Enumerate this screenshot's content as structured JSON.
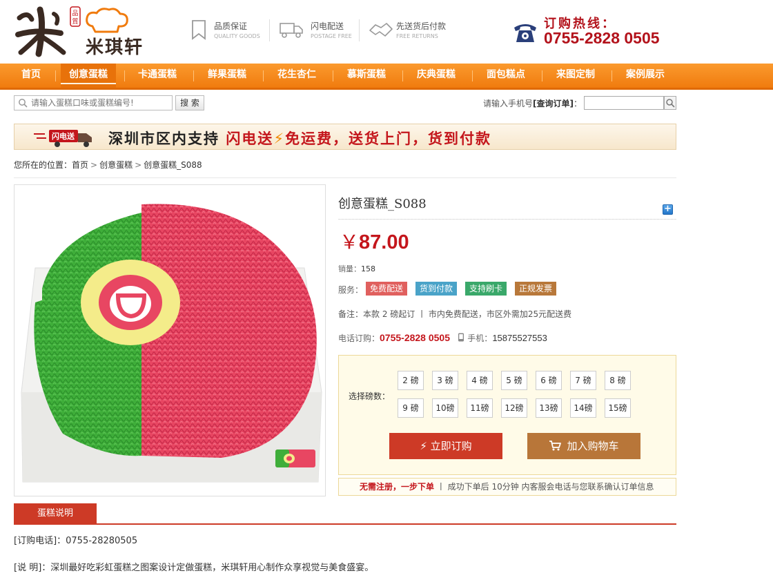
{
  "logo": {
    "text": "米琪轩"
  },
  "features": [
    {
      "title": "品质保证",
      "sub": "QUALITY GOODS",
      "icon": "bookmark-icon"
    },
    {
      "title": "闪电配送",
      "sub": "POSTAGE FREE",
      "icon": "truck-icon"
    },
    {
      "title": "先送货后付款",
      "sub": "FREE RETURNS",
      "icon": "handshake-icon"
    }
  ],
  "hotline": {
    "label": "订购热线：",
    "number": "0755-2828 0505"
  },
  "nav": [
    {
      "label": "首页"
    },
    {
      "label": "创意蛋糕"
    },
    {
      "label": "卡通蛋糕"
    },
    {
      "label": "鲜果蛋糕"
    },
    {
      "label": "花生杏仁"
    },
    {
      "label": "慕斯蛋糕"
    },
    {
      "label": "庆典蛋糕"
    },
    {
      "label": "面包糕点"
    },
    {
      "label": "来图定制"
    },
    {
      "label": "案例展示"
    }
  ],
  "search": {
    "placeholder": "请输入蛋糕口味或蛋糕编号!",
    "button": "搜 索"
  },
  "order_query": {
    "prefix": "请输入手机号",
    "label": "[查询订单]",
    "suffix": "："
  },
  "banner": {
    "part1": "深圳市区内支持",
    "part2": "闪电送",
    "bolt": "⚡",
    "part3": "免运费，送货上门，货到付款",
    "truck_label": "闪电送"
  },
  "breadcrumb": {
    "prefix": "您所在的位置：",
    "items": [
      "首页",
      "创意蛋糕",
      "创意蛋糕_S088"
    ],
    "sep": ">"
  },
  "product": {
    "title": "创意蛋糕_S088",
    "currency": "￥",
    "price": "87.00",
    "sales_label": "销量：",
    "sales": "158",
    "service_label": "服务：",
    "services": [
      {
        "label": "免费配送",
        "color": "#e0605e"
      },
      {
        "label": "货到付款",
        "color": "#4aa3c8"
      },
      {
        "label": "支持刷卡",
        "color": "#3aa86a"
      },
      {
        "label": "正规发票",
        "color": "#b8783a"
      }
    ],
    "note": "备注：本款 2 磅起订 丨 市内免费配送，市区外需加25元配送费",
    "phone_label": "电话订购：",
    "phone": "0755-2828 0505",
    "mobile_label": "手机：",
    "mobile": "15875527553"
  },
  "options": {
    "label": "选择磅数：",
    "weights": [
      "2 磅",
      "3 磅",
      "4 磅",
      "5 磅",
      "6 磅",
      "7 磅",
      "8 磅",
      "9 磅",
      "10磅",
      "11磅",
      "12磅",
      "13磅",
      "14磅",
      "15磅"
    ],
    "buy": "立即订购",
    "cart": "加入购物车"
  },
  "tip": {
    "highlight": "无需注册，一步下单",
    "rest": " 丨 成功下单后 10分钟 内客服会电话与您联系确认订单信息"
  },
  "description": {
    "tab": "蛋糕说明",
    "line1": "[订购电话]：0755-28280505",
    "line2": "[说 明]：深圳最好吃彩虹蛋糕之图案设计定做蛋糕，米琪轩用心制作众享视觉与美食盛宴。"
  },
  "colors": {
    "brand_orange": "#f07b0e",
    "price_red": "#c4161c",
    "buy_red": "#cd3a26",
    "cart_brown": "#b87639"
  }
}
